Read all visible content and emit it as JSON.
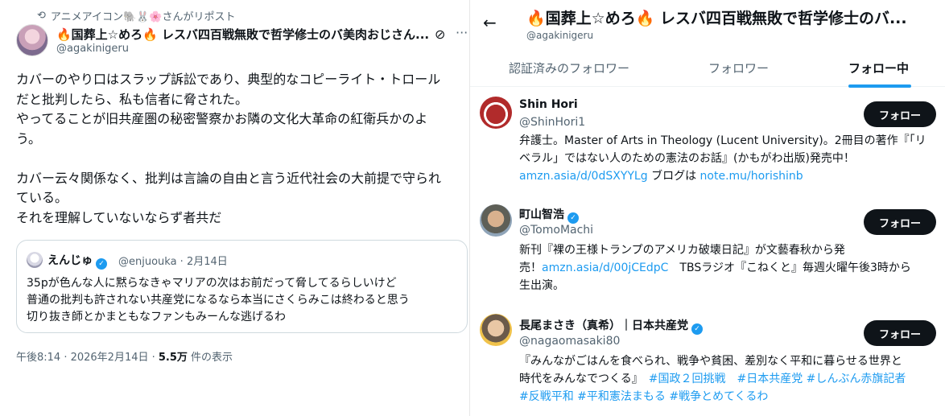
{
  "left": {
    "repost_label": "アニメアイコン🐘🐰🌸さんがリポスト",
    "author_name": "🔥国葬上☆めろ🔥 レスバ四百戦無敗で哲学修士のバ美肉おじさん...",
    "author_handle": "@agakinigeru",
    "body_lines": [
      "カバーのやり口はスラップ訴訟であり、典型的なコピーライト・トロール",
      "だと批判したら、私も信者に脅された。",
      "やってることが旧共産圏の秘密警察かお隣の文化大革命の紅衛兵かのよ",
      "う。",
      "",
      "カバー云々関係なく、批判は言論の自由と言う近代社会の大前提で守られ",
      "ている。",
      "それを理解していないならず者共だ"
    ],
    "quote": {
      "name": "えんじゅ",
      "handle_date": "@enjuouka · 2月14日",
      "lines": [
        "35pが色んな人に黙らなきゃマリアの次はお前だって脅してるらしいけど",
        "普通の批判も許されない共産党になるなら本当にさくらみこは終わると思う",
        "切り抜き師とかまともなファンもみーんな逃げるわ"
      ]
    },
    "timestamp": "午後8:14 · 2026年2月14日 · ",
    "views_count": "5.5万",
    "views_label": " 件の表示"
  },
  "right": {
    "title": "🔥国葬上☆めろ🔥 レスバ四百戦無敗で哲学修士のバ...",
    "handle": "@agakinigeru",
    "tabs": [
      "認証済みのフォロワー",
      "フォロワー",
      "フォロー中"
    ],
    "follow_label": "フォロー",
    "users": [
      {
        "name": "Shin Hori",
        "handle": "@ShinHori1",
        "bio": [
          "弁護士。Master of Arts in Theology (Lucent University)。2冊目の著作『「リ",
          "ベラル」ではない人のための憲法のお話』(かもがわ出版)発売中！"
        ],
        "bio_link1": "amzn.asia/d/0dSXYYLg",
        "bio_mid": " ブログは ",
        "bio_link2": "note.mu/horishinb"
      },
      {
        "name": "町山智浩",
        "handle": "@TomoMachi",
        "bio_line1": "新刊『裸の王様トランプのアメリカ破壊日記』が文藝春秋から発",
        "bio_line2_pre": "売！",
        "bio_link": "amzn.asia/d/00jCEdpC",
        "bio_line2_post": "　TBSラジオ『こねくと』毎週火曜午後3時から",
        "bio_line3": "生出演。"
      },
      {
        "name": "長尾まさき（真希）｜日本共産党",
        "handle": "@nagaomasaki80",
        "bio_line1": "『みんながごはんを食べられ、戦争や貧困、差別なく平和に暮らせる世界と",
        "bio_line2_pre": "時代をみんなでつくる』　",
        "bio_tags_line2": "#国政２回挑戦　#日本共産党 #しんぶん赤旗記者",
        "bio_tags_line3": "#反戦平和 #平和憲法まもる #戦争とめてくるわ"
      }
    ]
  },
  "colors": {
    "accent": "#1d9bf0",
    "text": "#0f1419",
    "muted": "#536471"
  }
}
